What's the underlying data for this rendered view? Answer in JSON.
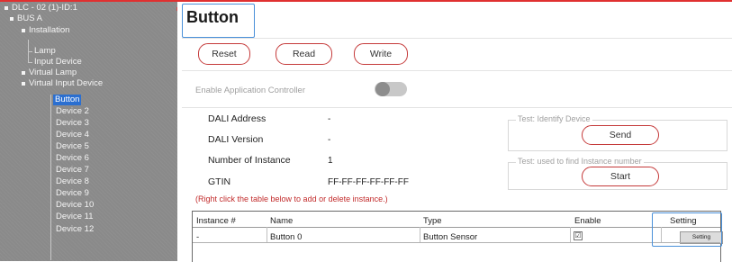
{
  "sidebar": {
    "items": [
      {
        "label": "DLC - 02 (1)-ID:1"
      },
      {
        "label": "BUS A"
      },
      {
        "label": "Installation"
      },
      {
        "label": "Lamp"
      },
      {
        "label": "Input Device"
      },
      {
        "label": "Virtual Lamp"
      },
      {
        "label": "Virtual Input Device"
      },
      {
        "label": "Button"
      },
      {
        "label": "Device 2"
      },
      {
        "label": "Device 3"
      },
      {
        "label": "Device 4"
      },
      {
        "label": "Device 5"
      },
      {
        "label": "Device 6"
      },
      {
        "label": "Device 7"
      },
      {
        "label": "Device 8"
      },
      {
        "label": "Device 9"
      },
      {
        "label": "Device 10"
      },
      {
        "label": "Device 11"
      },
      {
        "label": "Device 12"
      }
    ]
  },
  "header": {
    "title": "Button"
  },
  "toolbar": {
    "reset_label": "Reset",
    "read_label": "Read",
    "write_label": "Write"
  },
  "app_controller": {
    "label": "Enable Application Controller",
    "enabled": false
  },
  "info": {
    "rows": [
      {
        "label": "DALI Address",
        "value": "-"
      },
      {
        "label": "DALI Version",
        "value": "-"
      },
      {
        "label": "Number of Instance",
        "value": "1"
      },
      {
        "label": "GTIN",
        "value": "FF-FF-FF-FF-FF-FF"
      }
    ]
  },
  "test_identify": {
    "legend": "Test: Identify Device",
    "button": "Send"
  },
  "test_instance": {
    "legend": "Test: used to find Instance number",
    "button": "Start"
  },
  "hint": "(Right click the table below to add or delete instance.)",
  "table": {
    "columns": [
      "Instance #",
      "Name",
      "Type",
      "Enable",
      "Setting"
    ],
    "rows": [
      {
        "instance": "-",
        "name": "Button 0",
        "type": "Button Sensor",
        "enable_mark": "☑",
        "setting": "Setting"
      }
    ]
  },
  "colors": {
    "accent_red": "#c53a3a",
    "highlight_blue": "#4a90d9",
    "sidebar_bg": "#8a8a8a",
    "selected_bg": "#2b6fd0"
  }
}
